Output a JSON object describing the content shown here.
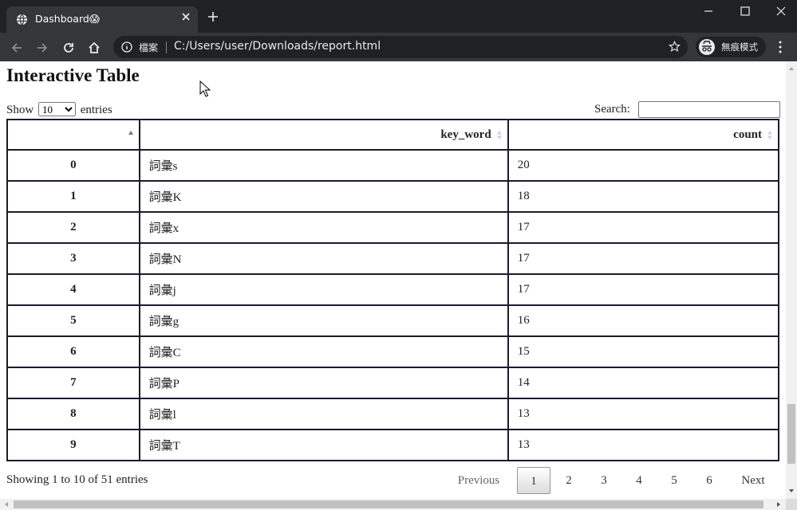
{
  "browser": {
    "tab_title": "Dashboard😱",
    "omnibox_scheme": "檔案",
    "url": "C:/Users/user/Downloads/report.html",
    "profile_label": "無痕模式"
  },
  "page": {
    "title": "Interactive Table",
    "length": {
      "show": "Show",
      "entries": "entries",
      "selected": "10"
    },
    "search_label": "Search:",
    "search_value": "",
    "headers": [
      "",
      "key_word",
      "count"
    ],
    "rows": [
      {
        "index": "0",
        "key_word": "詞彙s",
        "count": "20"
      },
      {
        "index": "1",
        "key_word": "詞彙K",
        "count": "18"
      },
      {
        "index": "2",
        "key_word": "詞彙x",
        "count": "17"
      },
      {
        "index": "3",
        "key_word": "詞彙N",
        "count": "17"
      },
      {
        "index": "4",
        "key_word": "詞彙j",
        "count": "17"
      },
      {
        "index": "5",
        "key_word": "詞彙g",
        "count": "16"
      },
      {
        "index": "6",
        "key_word": "詞彙C",
        "count": "15"
      },
      {
        "index": "7",
        "key_word": "詞彙P",
        "count": "14"
      },
      {
        "index": "8",
        "key_word": "詞彙l",
        "count": "13"
      },
      {
        "index": "9",
        "key_word": "詞彙T",
        "count": "13"
      }
    ],
    "info": "Showing 1 to 10 of 51 entries",
    "pagination": {
      "previous": "Previous",
      "pages": [
        "1",
        "2",
        "3",
        "4",
        "5",
        "6"
      ],
      "current": "1",
      "next": "Next"
    }
  },
  "colors": {
    "chrome_dark": "#202124",
    "chrome_tab": "#35363a",
    "table_border": "#1b1b2e"
  }
}
